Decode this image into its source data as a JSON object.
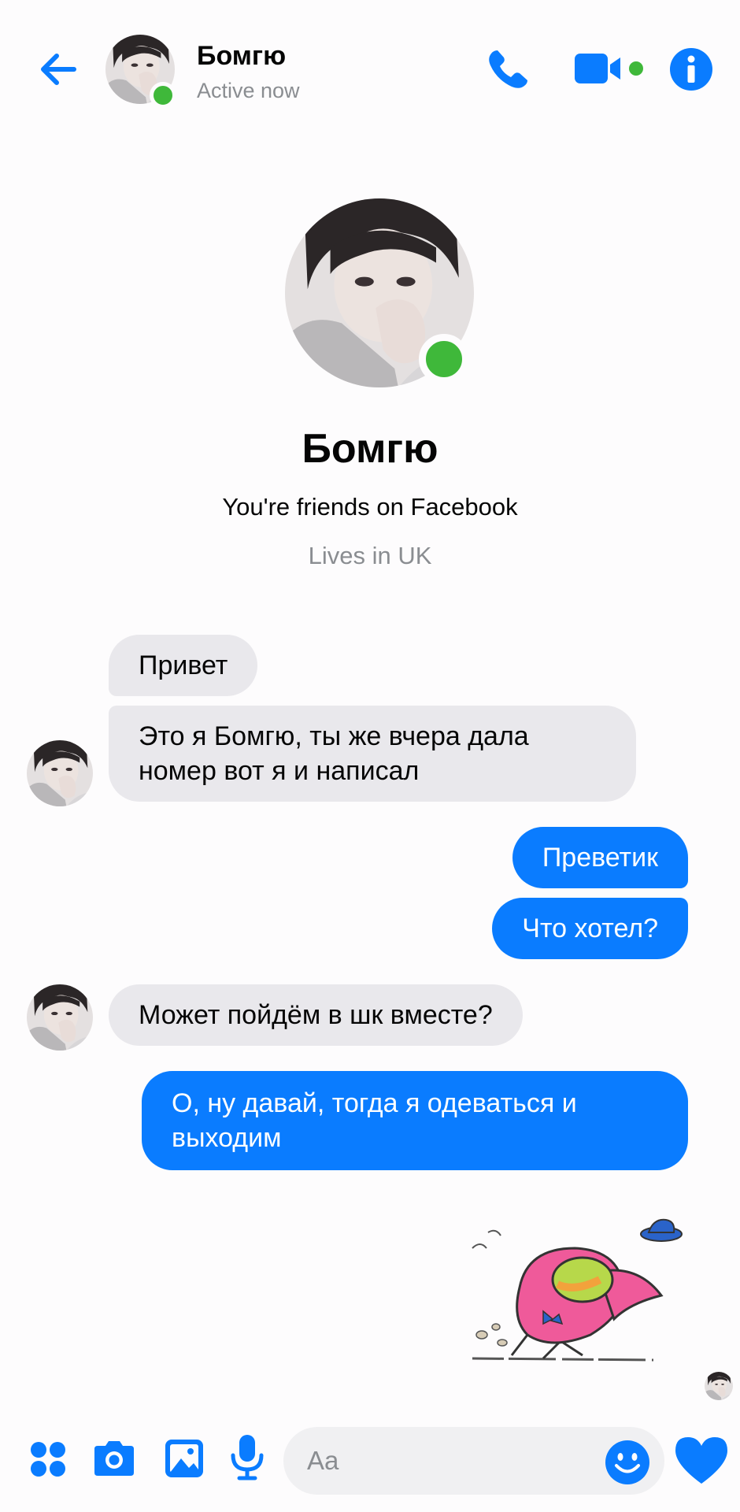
{
  "header": {
    "contact_name": "Бомгю",
    "status": "Active now"
  },
  "profile": {
    "name": "Бомгю",
    "friends_text": "You're friends on Facebook",
    "location_text": "Lives in UK"
  },
  "messages": [
    {
      "sender": "them",
      "text": "Привет"
    },
    {
      "sender": "them",
      "text": "Это я Бомгю, ты же вчера дала номер вот я и написал"
    },
    {
      "sender": "me",
      "text": "Преветик"
    },
    {
      "sender": "me",
      "text": "Что хотел?"
    },
    {
      "sender": "them",
      "text": "Может пойдём в шк вместе?"
    },
    {
      "sender": "me",
      "text": "О, ну давай, тогда я одеваться и выходим"
    }
  ],
  "composer": {
    "placeholder": "Aa"
  },
  "icons": {
    "back": "back-arrow-icon",
    "call": "phone-icon",
    "video": "video-camera-icon",
    "info": "info-icon",
    "apps": "four-dots-icon",
    "camera": "camera-icon",
    "gallery": "image-icon",
    "mic": "microphone-icon",
    "emoji": "emoji-icon",
    "like": "heart-icon"
  },
  "colors": {
    "accent": "#0a7cff",
    "online": "#3fb83a",
    "incoming_bubble": "#e9e8ec",
    "secondary_text": "#8a8d91"
  }
}
